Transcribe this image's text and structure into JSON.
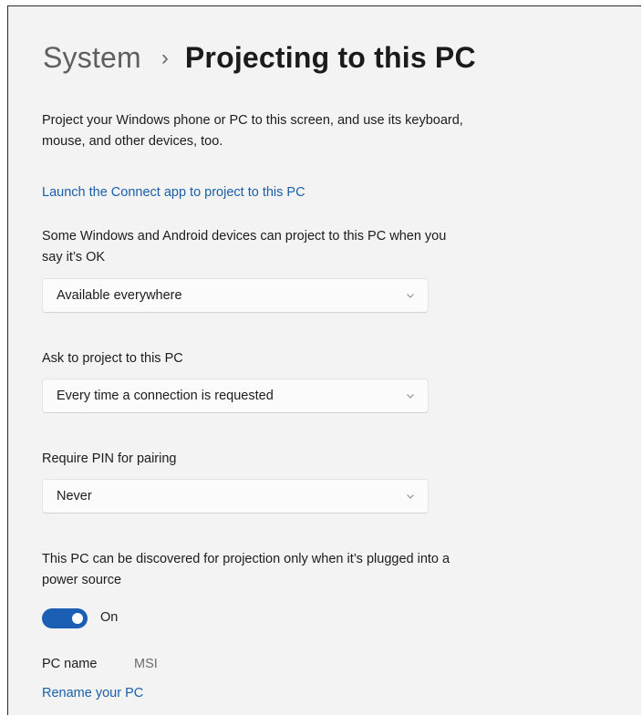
{
  "breadcrumb": {
    "parent": "System",
    "separator": "›",
    "current": "Projecting to this PC"
  },
  "description": {
    "line1": "Project your Windows phone or PC to this screen, and use its keyboard,",
    "line2": "mouse, and other devices, too."
  },
  "launch_link": "Launch the Connect app to project to this PC",
  "availability": {
    "label_line1": "Some Windows and Android devices can project to this PC when you",
    "label_line2": "say it’s OK",
    "value": "Available everywhere"
  },
  "ask_to_project": {
    "label": "Ask to project to this PC",
    "value": "Every time a connection is requested"
  },
  "require_pin": {
    "label": "Require PIN for pairing",
    "value": "Never"
  },
  "power_source": {
    "label_line1": "This PC can be discovered for projection only when it’s plugged into a",
    "label_line2": "power source",
    "toggle_state": "On",
    "toggle_on": true
  },
  "pc_name": {
    "label": "PC name",
    "value": "MSI"
  },
  "rename_link": "Rename your PC",
  "colors": {
    "accent": "#1a5fb4",
    "link": "#1a5fa8",
    "background": "#f3f3f3"
  },
  "icons": {
    "dropdown": "chevron-down-icon"
  }
}
